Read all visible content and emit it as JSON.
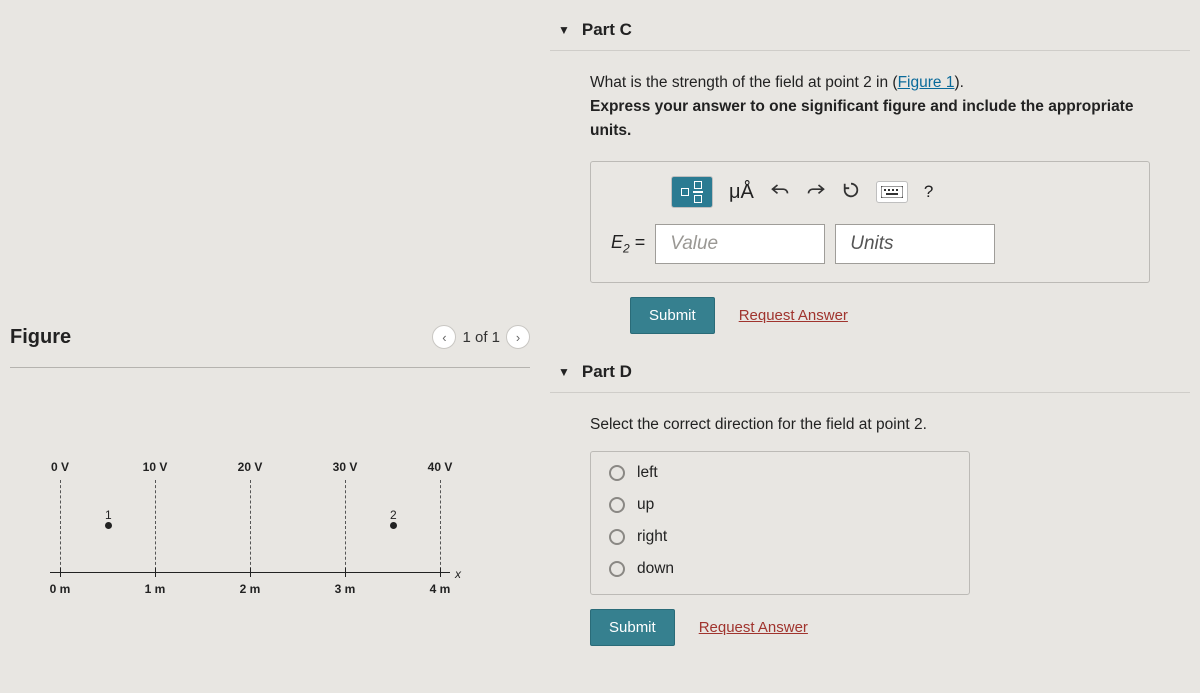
{
  "figure": {
    "title": "Figure",
    "nav": {
      "counter": "1 of 1"
    }
  },
  "chart_data": {
    "type": "equipotential-diagram",
    "equipotential_lines": [
      {
        "label": "0 V",
        "x_m": 0
      },
      {
        "label": "10 V",
        "x_m": 1
      },
      {
        "label": "20 V",
        "x_m": 2
      },
      {
        "label": "30 V",
        "x_m": 3
      },
      {
        "label": "40 V",
        "x_m": 4
      }
    ],
    "points": [
      {
        "name": "1",
        "x_m": 0.5
      },
      {
        "name": "2",
        "x_m": 3.5
      }
    ],
    "x_ticks": [
      {
        "label": "0 m",
        "x_m": 0
      },
      {
        "label": "1 m",
        "x_m": 1
      },
      {
        "label": "2 m",
        "x_m": 2
      },
      {
        "label": "3 m",
        "x_m": 3
      },
      {
        "label": "4 m",
        "x_m": 4
      }
    ],
    "x_axis_label": "x"
  },
  "partC": {
    "title": "Part C",
    "prompt_pre": "What is the strength of the field at point 2 in (",
    "prompt_link": "Figure 1",
    "prompt_post": ").",
    "instruction": "Express your answer to one significant figure and include the appropriate units.",
    "mu_label": "μÅ",
    "help_label": "?",
    "var_html": "E",
    "var_sub": "2",
    "equals": "=",
    "value_placeholder": "Value",
    "units_placeholder": "Units",
    "submit": "Submit",
    "request": "Request Answer"
  },
  "partD": {
    "title": "Part D",
    "prompt": "Select the correct direction for the field at point 2.",
    "options": [
      "left",
      "up",
      "right",
      "down"
    ],
    "submit": "Submit",
    "request": "Request Answer"
  }
}
